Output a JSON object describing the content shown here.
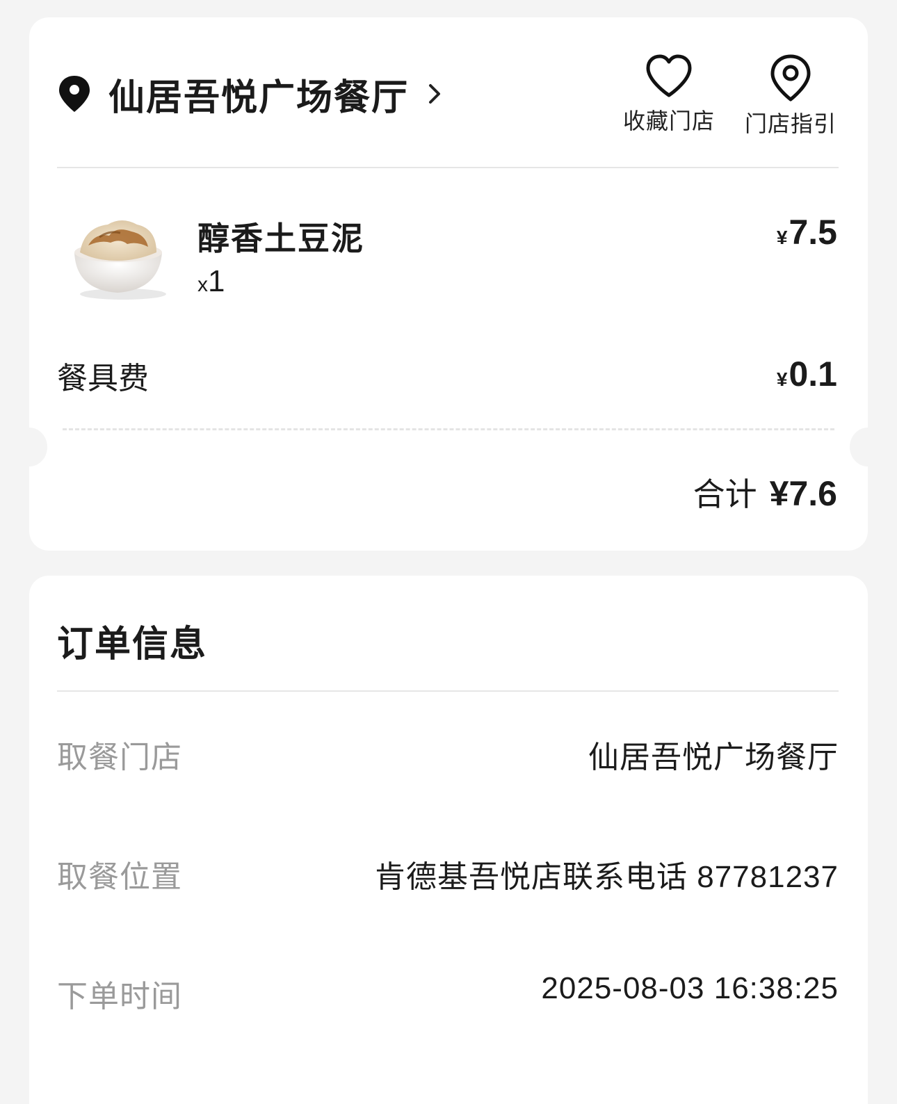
{
  "store": {
    "name": "仙居吾悦广场餐厅",
    "actions": {
      "favorite_label": "收藏门店",
      "guide_label": "门店指引"
    }
  },
  "items": [
    {
      "name": "醇香土豆泥",
      "quantity_prefix": "x",
      "quantity": "1",
      "currency": "¥",
      "price": "7.5"
    }
  ],
  "fees": {
    "label": "餐具费",
    "currency": "¥",
    "amount": "0.1"
  },
  "total": {
    "label": "合计",
    "value": "¥7.6"
  },
  "order_info": {
    "title": "订单信息",
    "rows": [
      {
        "label": "取餐门店",
        "value": "仙居吾悦广场餐厅"
      },
      {
        "label": "取餐位置",
        "value": "肯德基吾悦店联系电话 87781237"
      },
      {
        "label": "下单时间",
        "value": "2025-08-03 16:38:25"
      }
    ]
  },
  "icons": {
    "location": "location-pin-icon",
    "chevron": "chevron-right-icon",
    "favorite": "heart-icon",
    "guide": "map-pin-icon"
  },
  "colors": {
    "background": "#f4f4f4",
    "card": "#ffffff",
    "text_primary": "#1b1b1b",
    "text_secondary": "#9a9a9a"
  }
}
